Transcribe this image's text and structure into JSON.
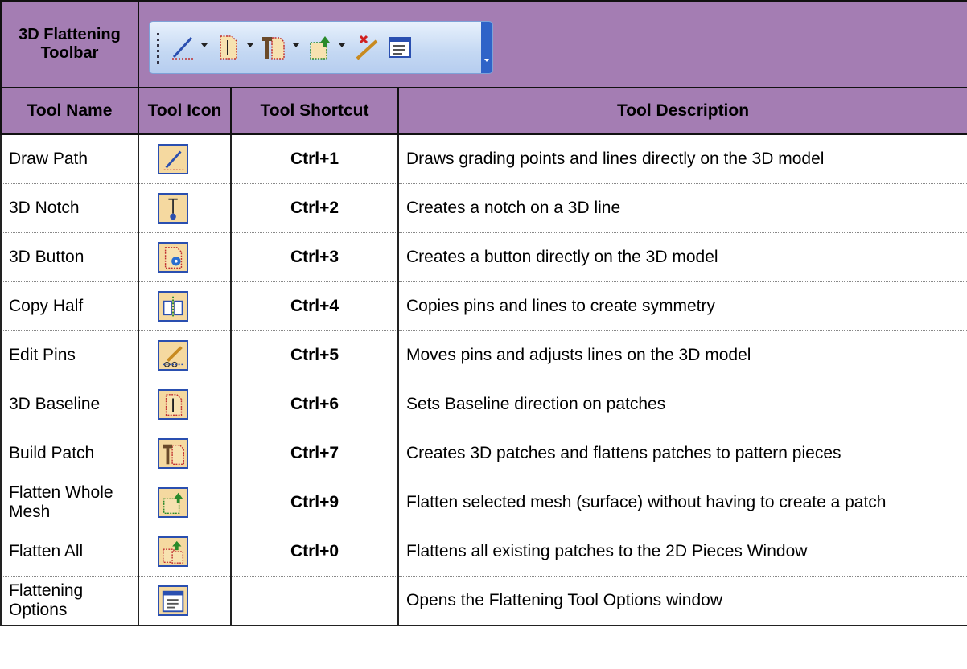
{
  "toolbar": {
    "title": "3D Flattening Toolbar",
    "icons": [
      "draw-path-icon",
      "baseline-icon",
      "build-patch-icon",
      "flatten-mesh-icon",
      "delete-pins-icon",
      "options-icon"
    ]
  },
  "headers": {
    "name": "Tool Name",
    "icon": "Tool Icon",
    "shortcut": "Tool Shortcut",
    "description": "Tool Description"
  },
  "colors": {
    "header_bg": "#a47db3",
    "icon_bg": "#f5d9a0",
    "icon_border": "#2a4fb0"
  },
  "tools": [
    {
      "name": "Draw Path",
      "icon": "draw-path-icon",
      "shortcut": "Ctrl+1",
      "description": "Draws grading points and lines directly on the 3D model"
    },
    {
      "name": "3D Notch",
      "icon": "notch-icon",
      "shortcut": "Ctrl+2",
      "description": "Creates a notch on a 3D line"
    },
    {
      "name": "3D Button",
      "icon": "button-icon",
      "shortcut": "Ctrl+3",
      "description": "Creates a button directly on the 3D model"
    },
    {
      "name": "Copy Half",
      "icon": "copy-half-icon",
      "shortcut": "Ctrl+4",
      "description": "Copies pins and lines to create symmetry"
    },
    {
      "name": "Edit Pins",
      "icon": "edit-pins-icon",
      "shortcut": "Ctrl+5",
      "description": "Moves pins and adjusts lines on the 3D model"
    },
    {
      "name": "3D Baseline",
      "icon": "baseline-icon",
      "shortcut": "Ctrl+6",
      "description": "Sets Baseline direction on patches"
    },
    {
      "name": "Build Patch",
      "icon": "build-patch-icon",
      "shortcut": "Ctrl+7",
      "description": "Creates 3D patches and flattens patches to pattern pieces"
    },
    {
      "name": "Flatten Whole Mesh",
      "icon": "flatten-mesh-icon",
      "shortcut": "Ctrl+9",
      "description": "Flatten selected mesh (surface) without having to create a patch"
    },
    {
      "name": "Flatten All",
      "icon": "flatten-all-icon",
      "shortcut": "Ctrl+0",
      "description": "Flattens all existing patches to the 2D Pieces Window"
    },
    {
      "name": "Flattening Options",
      "icon": "options-icon",
      "shortcut": "",
      "description": "Opens the Flattening Tool Options window"
    }
  ]
}
